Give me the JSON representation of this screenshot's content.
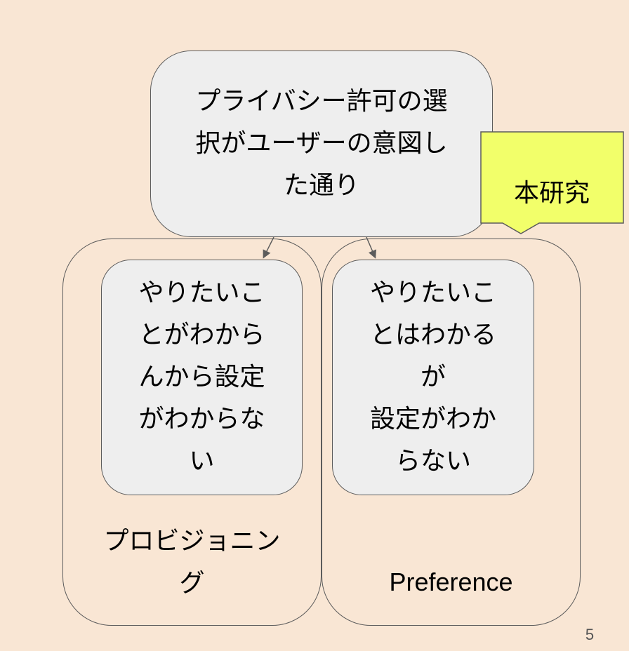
{
  "diagram": {
    "top_node": {
      "text": "プライバシー許可の選\n択がユーザーの意図し\nた通り"
    },
    "left_group": {
      "label": "プロビジョニン\nグ",
      "inner_text": "やりたいこ\nとがわから\nんから設定\nがわからな\nい"
    },
    "right_group": {
      "label": "Preference",
      "inner_text": "やりたいこ\nとはわかる\nが\n設定がわか\nらない"
    },
    "callout": {
      "text": "本研究"
    }
  },
  "page_number": "5",
  "colors": {
    "background": "#f9e6d4",
    "node_fill": "#eeeeee",
    "border": "#5c5c5c",
    "callout_fill": "#f2ff6a"
  }
}
